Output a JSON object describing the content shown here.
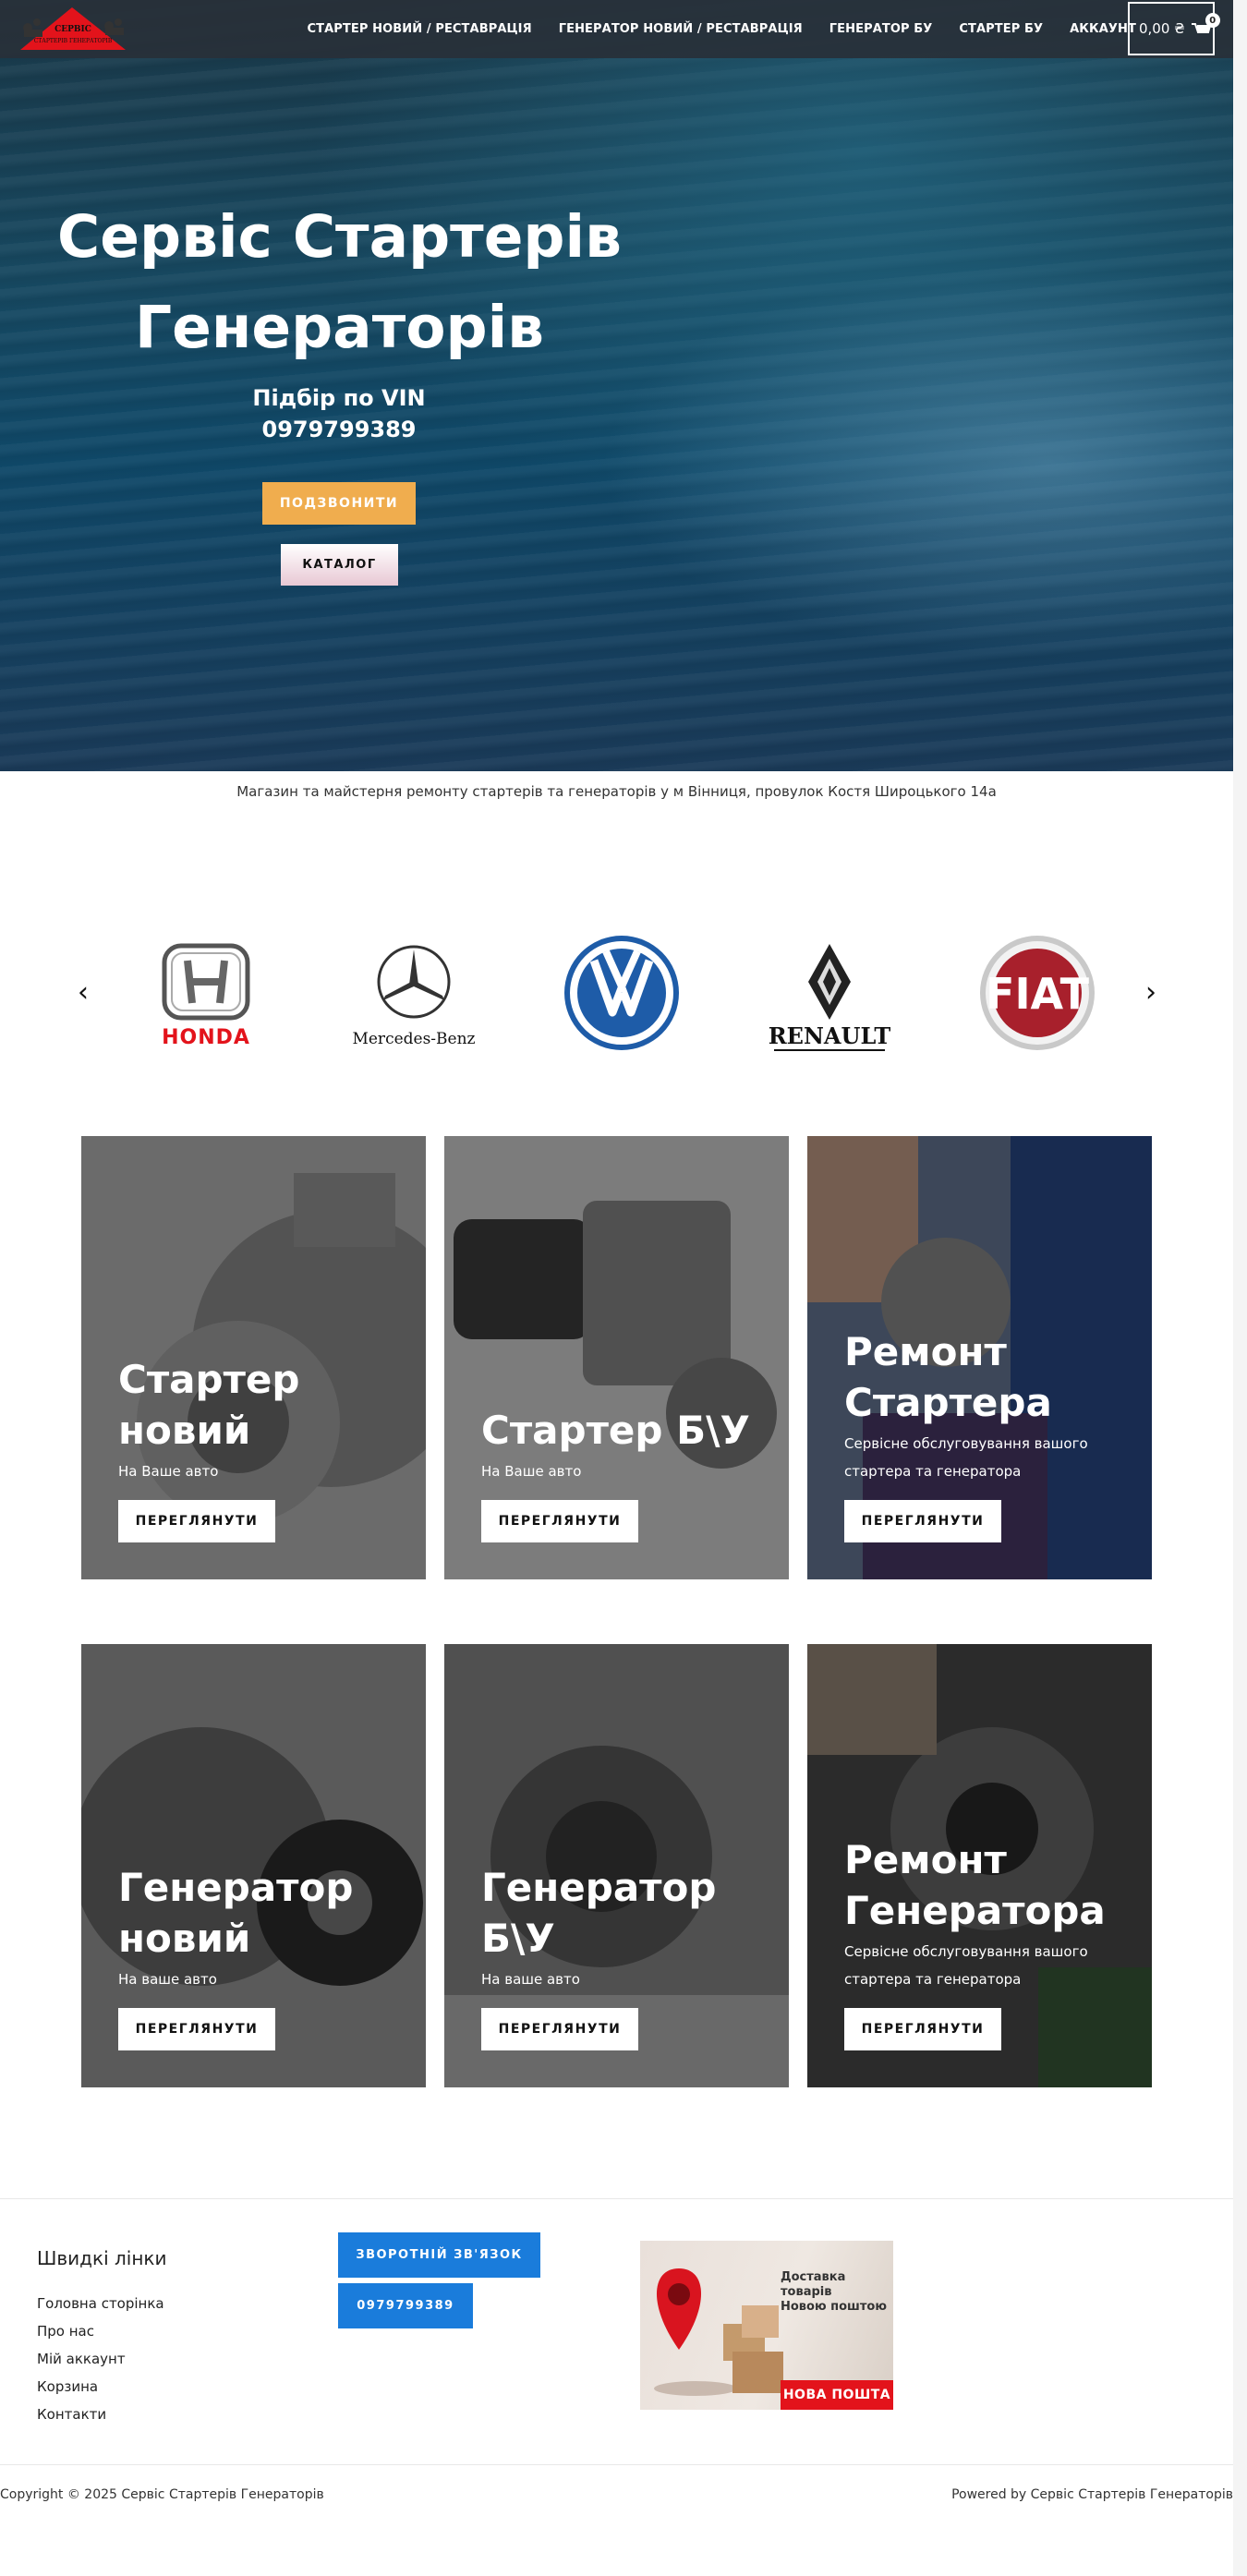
{
  "header": {
    "logo_text_top": "СЕРВІС",
    "logo_text_bottom": "СТАРТЕРІВ ГЕНЕРАТОРІВ",
    "nav": [
      {
        "label": "СТАРТЕР НОВИЙ / РЕСТАВРАЦІЯ"
      },
      {
        "label": "ГЕНЕРАТОР НОВИЙ / РЕСТАВРАЦІЯ"
      },
      {
        "label": "ГЕНЕРАТОР БУ"
      },
      {
        "label": "СТАРТЕР БУ"
      },
      {
        "label": "АККАУНТ"
      }
    ],
    "cart_total": "0,00 ₴",
    "cart_count": "0"
  },
  "hero": {
    "title_line1": "Сервіс Стартерів",
    "title_line2": "Генераторів",
    "sub_line1": "Підбір по VIN",
    "sub_line2": "0979799389",
    "call_button": "ПОДЗВОНИТИ",
    "catalog_button": "КАТАЛОГ"
  },
  "tagline": "Магазин та майстерня ремонту стартерів та генераторів у м Вінниця, провулок Костя Широцького 14а",
  "brands": {
    "prev": "‹",
    "next": "›",
    "items": [
      {
        "name": "HONDA"
      },
      {
        "name": "Mercedes-Benz"
      },
      {
        "name": "VW"
      },
      {
        "name": "RENAULT"
      },
      {
        "name": "FIAT"
      }
    ]
  },
  "cards": [
    {
      "title": "Стартер новий",
      "desc": "На Ваше авто",
      "button": "ПЕРЕГЛЯНУТИ"
    },
    {
      "title": "Стартер Б\\У",
      "desc": "На Ваше авто",
      "button": "ПЕРЕГЛЯНУТИ"
    },
    {
      "title": "Ремонт Стартера",
      "desc": "Сервісне обслуговування вашого стартера та генератора",
      "button": "ПЕРЕГЛЯНУТИ"
    },
    {
      "title": "Генератор новий",
      "desc": "На ваше авто",
      "button": "ПЕРЕГЛЯНУТИ"
    },
    {
      "title": "Генератор Б\\У",
      "desc": "На ваше авто",
      "button": "ПЕРЕГЛЯНУТИ"
    },
    {
      "title": "Ремонт Генератора",
      "desc": "Сервісне обслуговування вашого стартера та генератора",
      "button": "ПЕРЕГЛЯНУТИ"
    }
  ],
  "footer": {
    "quick_title": "Швидкі лінки",
    "links": [
      {
        "label": "Головна сторінка"
      },
      {
        "label": "Про нас"
      },
      {
        "label": "Мій аккаунт"
      },
      {
        "label": "Корзина"
      },
      {
        "label": "Контакти"
      }
    ],
    "feedback_button": "ЗВОРОТНІЙ ЗВ'ЯЗОК",
    "phone_button": "0979799389",
    "np_text_line1": "Доставка",
    "np_text_line2": "товарів",
    "np_text_line3": "Новою поштою",
    "np_badge": "НОВА ПОШТА",
    "copyright": "Copyright © 2025 Сервіс Стартерів Генераторів",
    "powered": "Powered by Сервіс Стартерів Генераторів"
  }
}
